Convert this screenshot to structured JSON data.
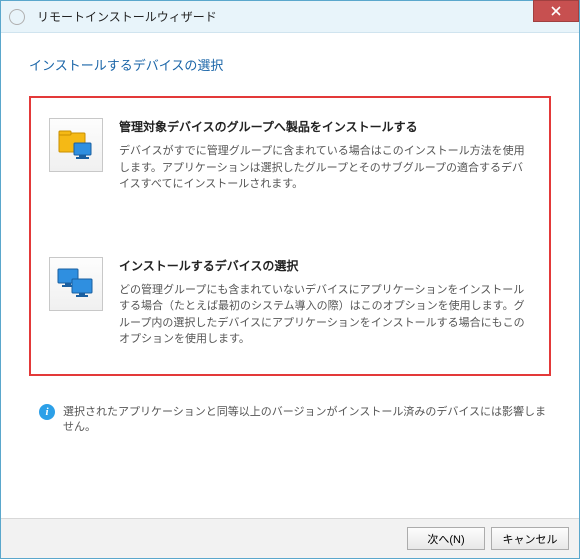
{
  "window": {
    "title": "リモートインストールウィザード"
  },
  "subtitle": "インストールするデバイスの選択",
  "options": [
    {
      "heading": "管理対象デバイスのグループへ製品をインストールする",
      "desc": "デバイスがすでに管理グループに含まれている場合はこのインストール方法を使用します。アプリケーションは選択したグループとそのサブグループの適合するデバイスすべてにインストールされます。"
    },
    {
      "heading": "インストールするデバイスの選択",
      "desc": "どの管理グループにも含まれていないデバイスにアプリケーションをインストールする場合（たとえば最初のシステム導入の際）はこのオプションを使用します。グループ内の選択したデバイスにアプリケーションをインストールする場合にもこのオプションを使用します。"
    }
  ],
  "info": "選択されたアプリケーションと同等以上のバージョンがインストール済みのデバイスには影響しません。",
  "footer": {
    "next": "次へ(N)",
    "cancel": "キャンセル"
  }
}
